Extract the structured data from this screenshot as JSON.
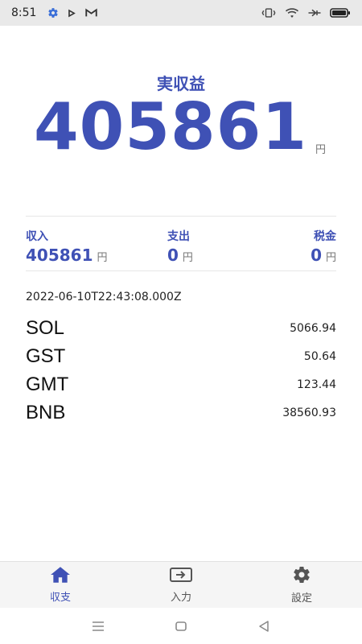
{
  "status_bar": {
    "time": "8:51",
    "left_icons": [
      "gear-icon",
      "play-store-icon",
      "gmail-icon"
    ],
    "right_icons": [
      "vibrate-icon",
      "wifi-icon",
      "bluetooth-icon",
      "battery-icon"
    ]
  },
  "hero": {
    "label": "実収益",
    "value": "405861",
    "unit": "円"
  },
  "summary": {
    "income": {
      "label": "収入",
      "value": "405861",
      "unit": "円"
    },
    "expense": {
      "label": "支出",
      "value": "0",
      "unit": "円"
    },
    "tax": {
      "label": "税金",
      "value": "0",
      "unit": "円"
    }
  },
  "timestamp": "2022-06-10T22:43:08.000Z",
  "holdings": [
    {
      "symbol": "SOL",
      "amount": "5066.94"
    },
    {
      "symbol": "GST",
      "amount": "50.64"
    },
    {
      "symbol": "GMT",
      "amount": "123.44"
    },
    {
      "symbol": "BNB",
      "amount": "38560.93"
    }
  ],
  "bottom_nav": {
    "items": [
      {
        "label": "収支",
        "icon": "home-icon",
        "active": true
      },
      {
        "label": "入力",
        "icon": "input-icon",
        "active": false
      },
      {
        "label": "設定",
        "icon": "gear-icon",
        "active": false
      }
    ]
  },
  "system_nav": [
    "menu-icon",
    "home-square-icon",
    "back-triangle-icon"
  ],
  "colors": {
    "accent": "#3f51b5",
    "status_bar_bg": "#e9e9e9",
    "nav_bg": "#f5f5f5"
  }
}
